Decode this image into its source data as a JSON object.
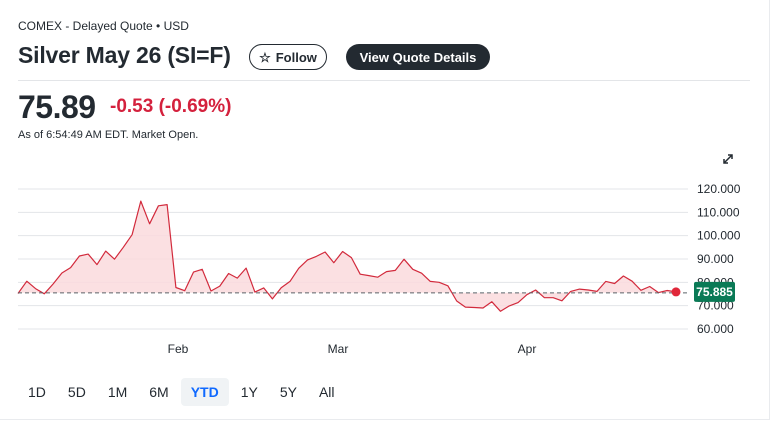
{
  "header": {
    "exchange": "COMEX - Delayed Quote • USD",
    "title": "Silver May 26 (SI=F)",
    "follow_label": "Follow",
    "details_label": "View Quote Details"
  },
  "quote": {
    "price": "75.89",
    "change": "-0.53 (-0.69%)",
    "as_of": "As of 6:54:49 AM EDT. Market Open."
  },
  "icons": {
    "follow": "star-icon",
    "expand": "expand-icon"
  },
  "colors": {
    "line": "#d22a3c",
    "fill": "#fadadd",
    "marker": "#e0273a",
    "last_badge": "#0a7a56",
    "negative": "#d4213d"
  },
  "chart_data": {
    "type": "area",
    "ylim": [
      60,
      120
    ],
    "yticks": [
      "120.000",
      "110.000",
      "100.000",
      "90.000",
      "80.000",
      "70.000",
      "60.000"
    ],
    "ytick_values": [
      120,
      110,
      100,
      90,
      80,
      70,
      60
    ],
    "xticks": [
      "Feb",
      "Mar",
      "Apr"
    ],
    "reference_value": 75.5,
    "last_value_label": "75.885",
    "last_value": 75.885,
    "y": [
      75.2,
      80.5,
      77.3,
      75.1,
      79.3,
      84.0,
      86.3,
      91.3,
      92.1,
      87.6,
      93.4,
      89.9,
      95.0,
      100.4,
      114.8,
      105.1,
      112.8,
      113.3,
      77.8,
      76.4,
      84.4,
      85.6,
      76.3,
      78.4,
      83.8,
      81.8,
      86.1,
      75.8,
      77.6,
      72.9,
      77.7,
      80.4,
      86.0,
      89.6,
      91.1,
      93.0,
      88.4,
      93.2,
      90.6,
      83.5,
      82.9,
      82.2,
      84.6,
      85.1,
      89.9,
      85.6,
      83.9,
      80.4,
      80.0,
      78.5,
      72.0,
      69.4,
      69.2,
      69.0,
      71.7,
      67.6,
      69.9,
      71.3,
      74.7,
      76.7,
      73.4,
      73.4,
      72.1,
      76.1,
      77.1,
      76.7,
      76.1,
      80.4,
      79.5,
      82.7,
      80.5,
      76.6,
      78.2,
      75.6,
      76.5,
      75.885
    ]
  },
  "ranges": {
    "items": [
      {
        "label": "1D",
        "name": "range-1d"
      },
      {
        "label": "5D",
        "name": "range-5d"
      },
      {
        "label": "1M",
        "name": "range-1m"
      },
      {
        "label": "6M",
        "name": "range-6m"
      },
      {
        "label": "YTD",
        "name": "range-ytd"
      },
      {
        "label": "1Y",
        "name": "range-1y"
      },
      {
        "label": "5Y",
        "name": "range-5y"
      },
      {
        "label": "All",
        "name": "range-all"
      }
    ],
    "active": "YTD"
  }
}
